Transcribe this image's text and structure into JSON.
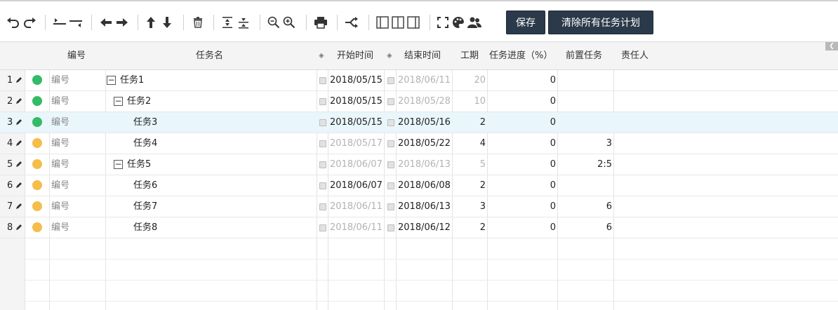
{
  "toolbar": {
    "icons": [
      "undo-icon",
      "redo-icon",
      "indent-icon",
      "outdent-icon",
      "arrow-left-icon",
      "arrow-right-icon",
      "arrow-up-icon",
      "arrow-down-icon",
      "trash-icon",
      "expand-all-icon",
      "collapse-all-icon",
      "zoom-out-icon",
      "zoom-in-icon",
      "print-icon",
      "critical-path-icon",
      "layout-grid-only-icon",
      "layout-both-icon",
      "layout-chart-only-icon",
      "fullscreen-icon",
      "palette-icon",
      "resource-icon"
    ],
    "save_label": "保存",
    "clear_label": "清除所有任务计划",
    "button_color": "#2b3a4a"
  },
  "header": {
    "col_code": "编号",
    "col_name": "任务名",
    "col_start": "开始时间",
    "col_end": "结束时间",
    "col_duration": "工期",
    "col_progress": "任务进度（%）",
    "col_predecessor": "前置任务",
    "col_owner": "责任人"
  },
  "status_colors": {
    "green": "#33bb66",
    "yellow": "#f5bd4a"
  },
  "rows": [
    {
      "num": "1",
      "status": "green",
      "code": "编号",
      "name": "任务1",
      "level": 0,
      "toggle": "−",
      "start": "2018/05/15",
      "start_dim": false,
      "end": "2018/06/11",
      "end_dim": true,
      "duration": "20",
      "duration_dim": true,
      "progress": "0",
      "pred": "",
      "owner": ""
    },
    {
      "num": "2",
      "status": "green",
      "code": "编号",
      "name": "任务2",
      "level": 1,
      "toggle": "−",
      "start": "2018/05/15",
      "start_dim": false,
      "end": "2018/05/28",
      "end_dim": true,
      "duration": "10",
      "duration_dim": true,
      "progress": "0",
      "pred": "",
      "owner": ""
    },
    {
      "num": "3",
      "status": "green",
      "code": "编号",
      "name": "任务3",
      "level": 2,
      "toggle": "",
      "start": "2018/05/15",
      "start_dim": false,
      "end": "2018/05/16",
      "end_dim": false,
      "duration": "2",
      "duration_dim": false,
      "progress": "0",
      "pred": "",
      "owner": "",
      "selected": true
    },
    {
      "num": "4",
      "status": "yellow",
      "code": "编号",
      "name": "任务4",
      "level": 2,
      "toggle": "",
      "start": "2018/05/17",
      "start_dim": true,
      "end": "2018/05/22",
      "end_dim": false,
      "duration": "4",
      "duration_dim": false,
      "progress": "0",
      "pred": "3",
      "owner": ""
    },
    {
      "num": "5",
      "status": "yellow",
      "code": "编号",
      "name": "任务5",
      "level": 1,
      "toggle": "−",
      "start": "2018/06/07",
      "start_dim": true,
      "end": "2018/06/13",
      "end_dim": true,
      "duration": "5",
      "duration_dim": true,
      "progress": "0",
      "pred": "2:5",
      "owner": ""
    },
    {
      "num": "6",
      "status": "yellow",
      "code": "编号",
      "name": "任务6",
      "level": 2,
      "toggle": "",
      "start": "2018/06/07",
      "start_dim": false,
      "end": "2018/06/08",
      "end_dim": false,
      "duration": "2",
      "duration_dim": false,
      "progress": "0",
      "pred": "",
      "owner": ""
    },
    {
      "num": "7",
      "status": "yellow",
      "code": "编号",
      "name": "任务7",
      "level": 2,
      "toggle": "",
      "start": "2018/06/11",
      "start_dim": true,
      "end": "2018/06/13",
      "end_dim": false,
      "duration": "3",
      "duration_dim": false,
      "progress": "0",
      "pred": "6",
      "owner": ""
    },
    {
      "num": "8",
      "status": "yellow",
      "code": "编号",
      "name": "任务8",
      "level": 2,
      "toggle": "",
      "start": "2018/06/11",
      "start_dim": true,
      "end": "2018/06/12",
      "end_dim": false,
      "duration": "2",
      "duration_dim": false,
      "progress": "0",
      "pred": "6",
      "owner": ""
    }
  ]
}
